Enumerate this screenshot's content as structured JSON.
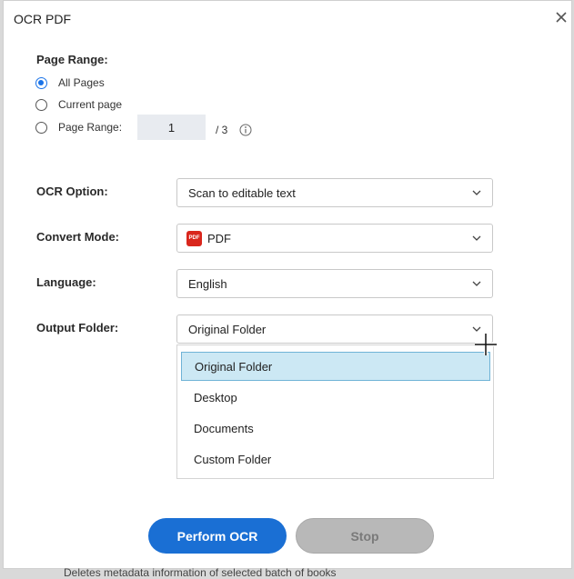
{
  "dialog": {
    "title": "OCR PDF"
  },
  "page_range": {
    "label": "Page Range:",
    "options": [
      {
        "label": "All Pages",
        "checked": true
      },
      {
        "label": "Current page",
        "checked": false
      },
      {
        "label": "Page Range:",
        "checked": false
      }
    ],
    "input_value": "1",
    "total": "/ 3"
  },
  "ocr_option": {
    "label": "OCR Option:",
    "value": "Scan to editable text"
  },
  "convert_mode": {
    "label": "Convert Mode:",
    "value": "PDF",
    "badge": "PDF"
  },
  "language": {
    "label": "Language:",
    "value": "English"
  },
  "output_folder": {
    "label": "Output Folder:",
    "value": "Original Folder",
    "options": [
      "Original Folder",
      "Desktop",
      "Documents",
      "Custom Folder"
    ]
  },
  "buttons": {
    "perform": "Perform OCR",
    "stop": "Stop"
  },
  "background": {
    "partial_text": "Deletes metadata information of selected batch of books"
  },
  "colors": {
    "accent": "#1a6fd4",
    "pdf_badge": "#d9261c",
    "dropdown_highlight": "#cce8f4"
  }
}
